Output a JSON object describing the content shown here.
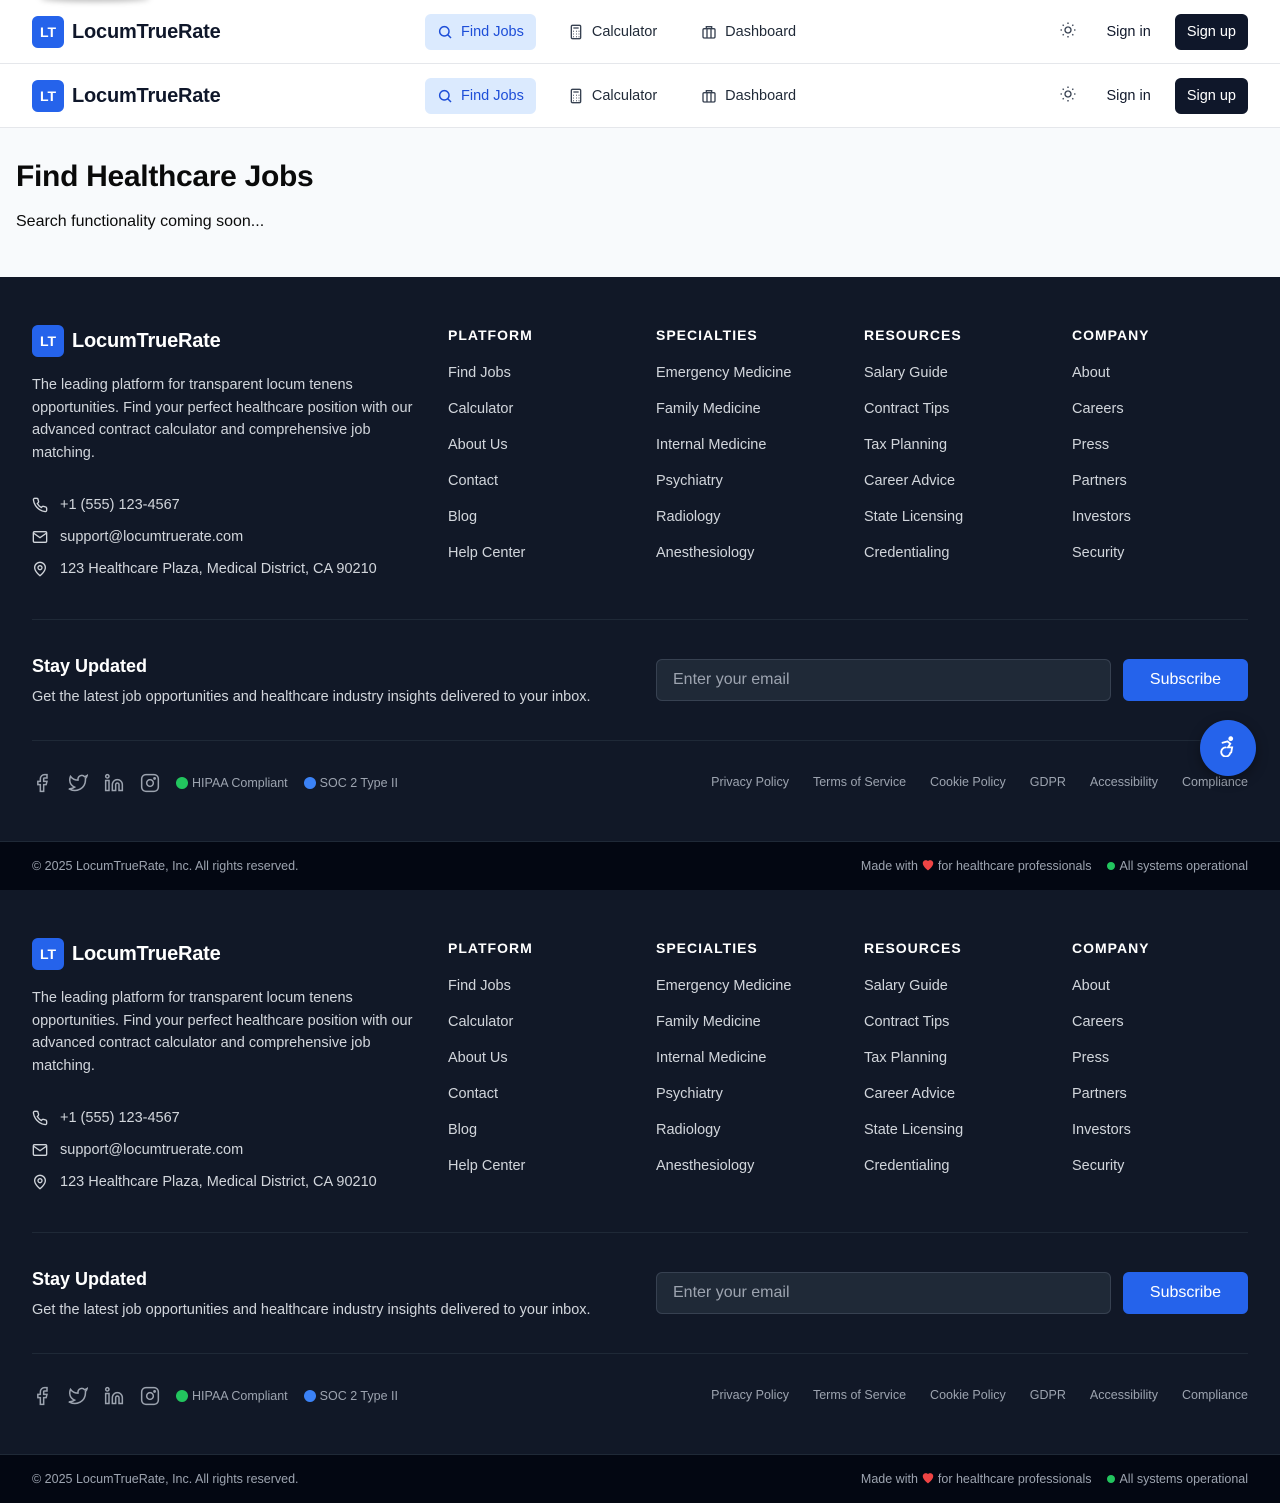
{
  "header": {
    "logo_text": "LT",
    "brand": "LocumTrueRate",
    "nav": [
      {
        "label": "Find Jobs",
        "icon": "search-icon"
      },
      {
        "label": "Calculator",
        "icon": "calculator-icon"
      },
      {
        "label": "Dashboard",
        "icon": "briefcase-icon"
      }
    ],
    "sign_in": "Sign in",
    "sign_up": "Sign up"
  },
  "main": {
    "title": "Find Healthcare Jobs",
    "subtitle": "Search functionality coming soon..."
  },
  "footer": {
    "logo_text": "LT",
    "brand": "LocumTrueRate",
    "description": "The leading platform for transparent locum tenens opportunities. Find your perfect healthcare position with our advanced contract calculator and comprehensive job matching.",
    "phone": "+1 (555) 123-4567",
    "email": "support@locumtruerate.com",
    "address": "123 Healthcare Plaza, Medical District, CA 90210",
    "columns": [
      {
        "title": "PLATFORM",
        "links": [
          "Find Jobs",
          "Calculator",
          "About Us",
          "Contact",
          "Blog",
          "Help Center"
        ]
      },
      {
        "title": "SPECIALTIES",
        "links": [
          "Emergency Medicine",
          "Family Medicine",
          "Internal Medicine",
          "Psychiatry",
          "Radiology",
          "Anesthesiology"
        ]
      },
      {
        "title": "RESOURCES",
        "links": [
          "Salary Guide",
          "Contract Tips",
          "Tax Planning",
          "Career Advice",
          "State Licensing",
          "Credentialing"
        ]
      },
      {
        "title": "COMPANY",
        "links": [
          "About",
          "Careers",
          "Press",
          "Partners",
          "Investors",
          "Security"
        ]
      }
    ],
    "newsletter": {
      "title": "Stay Updated",
      "subtitle": "Get the latest job opportunities and healthcare industry insights delivered to your inbox.",
      "placeholder": "Enter your email",
      "button": "Subscribe"
    },
    "badges": [
      {
        "label": "HIPAA Compliant",
        "color": "#22c55e"
      },
      {
        "label": "SOC 2 Type II",
        "color": "#3b82f6"
      }
    ],
    "legal_links": [
      "Privacy Policy",
      "Terms of Service",
      "Cookie Policy",
      "GDPR",
      "Accessibility",
      "Compliance"
    ],
    "copyright": "© 2025 LocumTrueRate, Inc. All rights reserved.",
    "made_with_prefix": "Made with",
    "made_with_suffix": "for healthcare professionals",
    "status": "All systems operational"
  },
  "colors": {
    "accent": "#2563eb",
    "footer_bg": "#111827",
    "active_nav_bg": "#dbeafe"
  }
}
